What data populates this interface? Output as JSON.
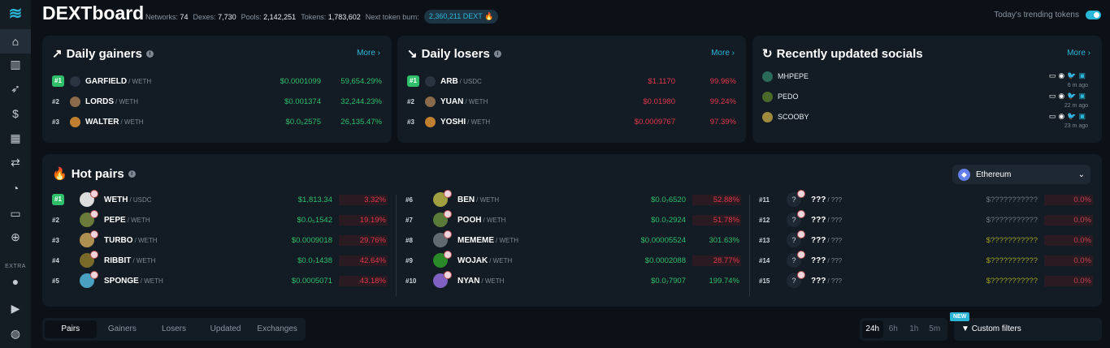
{
  "header": {
    "title": "DEXTboard",
    "stats": [
      {
        "label": "Networks:",
        "value": "74"
      },
      {
        "label": "Dexes:",
        "value": "7,730"
      },
      {
        "label": "Pools:",
        "value": "2,142,251"
      },
      {
        "label": "Tokens:",
        "value": "1,783,602"
      }
    ],
    "burn_label": "Next token burn:",
    "burn_value": "2,360,211 DEXT 🔥",
    "trending_label": "Today's trending tokens",
    "trending_on": true
  },
  "sidebar": {
    "extra_label": "EXTRA",
    "items": [
      "home-icon",
      "charts-icon",
      "rocket-icon",
      "dollar-icon",
      "apps-icon",
      "swap-icon",
      "pie-icon",
      "wallet-icon",
      "plus-icon",
      "fire-icon",
      "youtube-icon",
      "globe-icon"
    ]
  },
  "gainers": {
    "title": "Daily gainers",
    "more": "More ›",
    "rows": [
      {
        "rank": "#1",
        "name": "GARFIELD",
        "quote": "/ WETH",
        "price": "$0.0001099",
        "pct": "59,654.29%"
      },
      {
        "rank": "#2",
        "name": "LORDS",
        "quote": "/ WETH",
        "price": "$0.001374",
        "pct": "32,244.23%"
      },
      {
        "rank": "#3",
        "name": "WALTER",
        "quote": "/ WETH",
        "price": "$0.0₆2575",
        "pct": "26,135.47%"
      }
    ]
  },
  "losers": {
    "title": "Daily losers",
    "more": "More ›",
    "rows": [
      {
        "rank": "#1",
        "name": "ARB",
        "quote": "/ USDC",
        "price": "$1.1170",
        "pct": "99.96%"
      },
      {
        "rank": "#2",
        "name": "YUAN",
        "quote": "/ WETH",
        "price": "$0.01980",
        "pct": "99.24%"
      },
      {
        "rank": "#3",
        "name": "YOSHI",
        "quote": "/ WETH",
        "price": "$0.0009767",
        "pct": "97.39%"
      }
    ]
  },
  "socials": {
    "title": "Recently updated socials",
    "more": "More ›",
    "rows": [
      {
        "name": "MHPEPE",
        "ago": "6 m ago"
      },
      {
        "name": "PEDO",
        "ago": "22 m ago"
      },
      {
        "name": "SCOOBY",
        "ago": "23 m ago"
      }
    ]
  },
  "hot": {
    "title": "Hot pairs",
    "network": "Ethereum",
    "rows": [
      {
        "rank": "#1",
        "name": "WETH",
        "quote": "/ USDC",
        "price": "$1,813.34",
        "pct": "3.32%",
        "dir": "down"
      },
      {
        "rank": "#2",
        "name": "PEPE",
        "quote": "/ WETH",
        "price": "$0.0₅1542",
        "pct": "19.19%",
        "dir": "down"
      },
      {
        "rank": "#3",
        "name": "TURBO",
        "quote": "/ WETH",
        "price": "$0.0009018",
        "pct": "29.76%",
        "dir": "down"
      },
      {
        "rank": "#4",
        "name": "RIBBIT",
        "quote": "/ WETH",
        "price": "$0.0₇1438",
        "pct": "42.64%",
        "dir": "down"
      },
      {
        "rank": "#5",
        "name": "SPONGE",
        "quote": "/ WETH",
        "price": "$0.0005071",
        "pct": "43.18%",
        "dir": "down"
      },
      {
        "rank": "#6",
        "name": "BEN",
        "quote": "/ WETH",
        "price": "$0.0₇6520",
        "pct": "52.88%",
        "dir": "down"
      },
      {
        "rank": "#7",
        "name": "POOH",
        "quote": "/ WETH",
        "price": "$0.0₇2924",
        "pct": "51.78%",
        "dir": "down"
      },
      {
        "rank": "#8",
        "name": "MEMEME",
        "quote": "/ WETH",
        "price": "$0.00005524",
        "pct": "301.63%",
        "dir": "up"
      },
      {
        "rank": "#9",
        "name": "WOJAK",
        "quote": "/ WETH",
        "price": "$0.0002088",
        "pct": "28.77%",
        "dir": "down"
      },
      {
        "rank": "#10",
        "name": "NYAN",
        "quote": "/ WETH",
        "price": "$0.0₇7907",
        "pct": "199.74%",
        "dir": "up"
      },
      {
        "rank": "#11",
        "name": "???",
        "quote": "/ ???",
        "price": "$???????????",
        "pct": "0.0%",
        "dir": "zero"
      },
      {
        "rank": "#12",
        "name": "???",
        "quote": "/ ???",
        "price": "$???????????",
        "pct": "0.0%",
        "dir": "zero"
      },
      {
        "rank": "#13",
        "name": "???",
        "quote": "/ ???",
        "price": "$???????????",
        "pct": "0.0%",
        "dir": "zero"
      },
      {
        "rank": "#14",
        "name": "???",
        "quote": "/ ???",
        "price": "$???????????",
        "pct": "0.0%",
        "dir": "zero"
      },
      {
        "rank": "#15",
        "name": "???",
        "quote": "/ ???",
        "price": "$???????????",
        "pct": "0.0%",
        "dir": "zero"
      }
    ]
  },
  "tabs": [
    "Pairs",
    "Gainers",
    "Losers",
    "Updated",
    "Exchanges"
  ],
  "times": [
    "24h",
    "6h",
    "1h",
    "5m"
  ],
  "filters": {
    "badge": "NEW",
    "label": "Custom filters"
  }
}
